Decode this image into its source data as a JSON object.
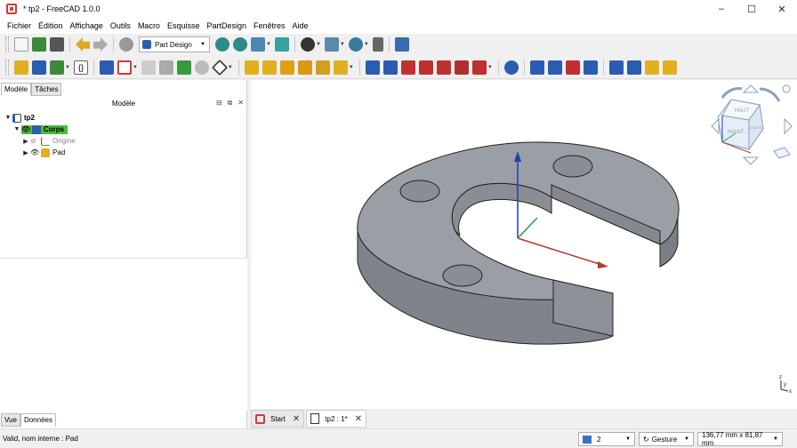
{
  "window": {
    "title": "* tp2 - FreeCAD 1.0.0",
    "minimize": "–",
    "maximize": "☐",
    "close": "✕"
  },
  "menu": [
    "Fichier",
    "Édition",
    "Affichage",
    "Outils",
    "Macro",
    "Esquisse",
    "PartDesign",
    "Fenêtres",
    "Aide"
  ],
  "toolbar": {
    "workbench": "Part Design"
  },
  "left_panel": {
    "tabs": [
      "Modèle",
      "Tâches"
    ],
    "header": "Modèle",
    "tree": {
      "document": "tp2",
      "body": "Corps",
      "origin": "Origine",
      "pad": "Pad"
    },
    "bottom_tabs": [
      "Vue",
      "Données"
    ]
  },
  "navcube": {
    "top": "HAUT",
    "front": "AVANT",
    "right": "DROITE"
  },
  "axis_labels": {
    "z": "z",
    "y": "y",
    "x": "x"
  },
  "doc_tabs": [
    {
      "label": "Start"
    },
    {
      "label": "tp2 : 1*"
    }
  ],
  "status": {
    "message": "Valid, nom interne : Pad",
    "selector": "2",
    "navigation": "Gesture",
    "dimensions": "136,77 mm x 81,87 mm"
  },
  "colors": {
    "selected_bg": "#4fb83a",
    "part_top": "#9a9ea5",
    "part_side": "#7f838a",
    "axis_z": "#1f3fb3",
    "axis_x": "#b33a2f",
    "axis_y": "#2f9a3a"
  }
}
